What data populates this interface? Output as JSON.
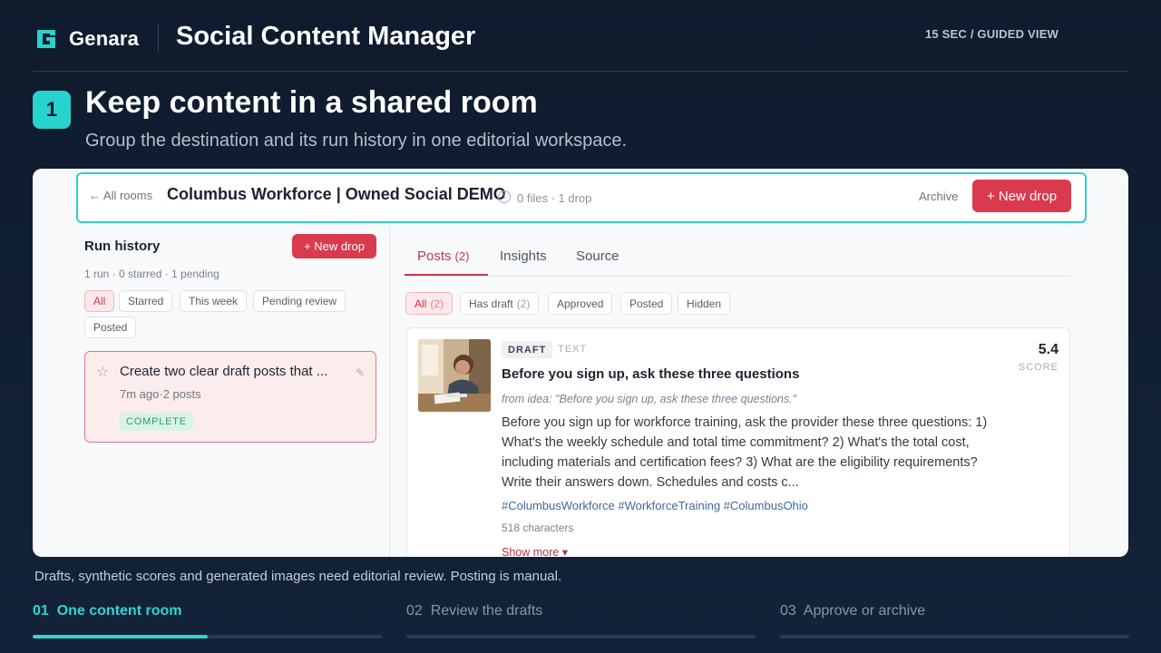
{
  "header": {
    "brand": "Genara",
    "app_title": "Social Content Manager",
    "guided_label": "15 SEC / GUIDED VIEW"
  },
  "step": {
    "number": "1",
    "title": "Keep content in a shared room",
    "subtitle": "Group the destination and its run history in one editorial workspace."
  },
  "room": {
    "back_label": "← All rooms",
    "name": "Columbus Workforce | Owned Social DEMO",
    "meta": "0 files · 1 drop",
    "archive_label": "Archive",
    "new_drop_label": "+ New drop"
  },
  "run_history": {
    "title": "Run history",
    "new_drop_label": "+ New drop",
    "meta": "1 run · 0 starred · 1 pending",
    "filters": [
      "All",
      "Starred",
      "This week",
      "Pending review",
      "Posted"
    ],
    "active_filter": "All",
    "run": {
      "title": "Create two clear draft posts that ...",
      "meta": "7m ago·2 posts",
      "status": "COMPLETE"
    }
  },
  "tabs": [
    {
      "label": "Posts",
      "count": "(2)",
      "active": true
    },
    {
      "label": "Insights",
      "count": "",
      "active": false
    },
    {
      "label": "Source",
      "count": "",
      "active": false
    }
  ],
  "post_filters": [
    {
      "label": "All",
      "count": "(2)",
      "active": true
    },
    {
      "label": "Has draft",
      "count": "(2)",
      "active": false
    },
    {
      "label": "Approved",
      "count": "",
      "active": false
    },
    {
      "label": "Posted",
      "count": "",
      "active": false
    },
    {
      "label": "Hidden",
      "count": "",
      "active": false
    }
  ],
  "post": {
    "status_tag": "DRAFT",
    "type_tag": "TEXT",
    "score": "5.4",
    "score_label": "SCORE",
    "title": "Before you sign up, ask these three questions",
    "idea": "from idea: \"Before you sign up, ask these three questions.\"",
    "body": "Before you sign up for workforce training, ask the provider these three questions: 1) What's the weekly schedule and total time commitment? 2) What's the total cost, including materials and certification fees? 3) What are the eligibility requirements? Write their answers down. Schedules and costs c...",
    "hashtags": "#ColumbusWorkforce #WorkforceTraining #ColumbusOhio",
    "char_count": "518 characters",
    "show_more_label": "Show more ▾"
  },
  "footer": {
    "disclaimer": "Drafts, synthetic scores and generated images need editorial review. Posting is manual.",
    "progress": [
      {
        "label": "01  One content room",
        "active": true,
        "fill": 0.5
      },
      {
        "label": "02  Review the drafts",
        "active": false,
        "fill": 0
      },
      {
        "label": "03  Approve or archive",
        "active": false,
        "fill": 0
      }
    ]
  },
  "colors": {
    "accent": "#2fd6cf",
    "primary_button": "#d93a4e",
    "background": "#0f1b2d"
  }
}
